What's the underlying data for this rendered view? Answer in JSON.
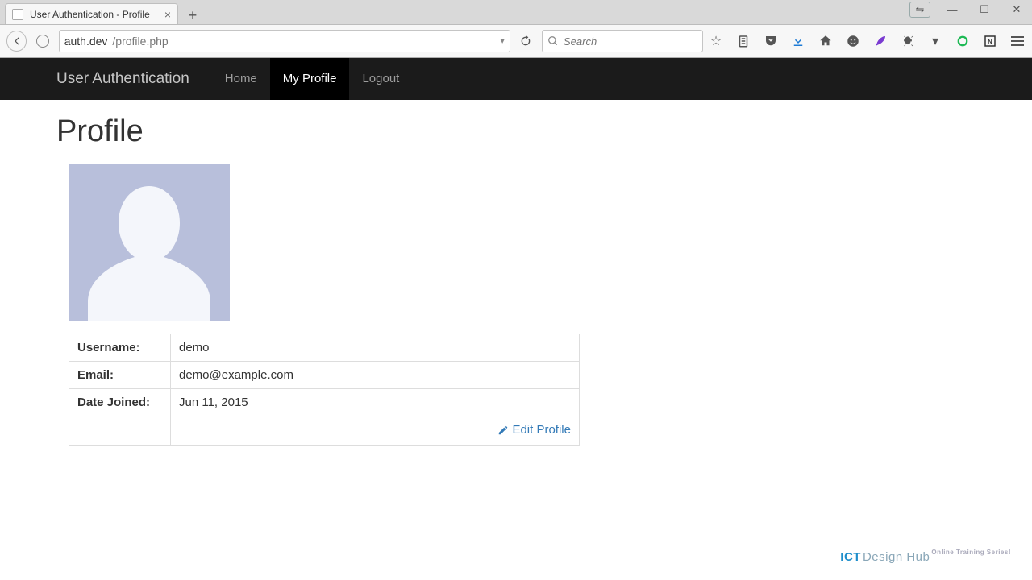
{
  "browser": {
    "tab_title": "User Authentication - Profile",
    "url_host": "auth.dev",
    "url_path": "/profile.php",
    "search_placeholder": "Search"
  },
  "navbar": {
    "brand": "User Authentication",
    "links": {
      "home": "Home",
      "profile": "My Profile",
      "logout": "Logout"
    }
  },
  "page": {
    "heading": "Profile"
  },
  "profile": {
    "labels": {
      "username": "Username:",
      "email": "Email:",
      "date_joined": "Date Joined:"
    },
    "values": {
      "username": "demo",
      "email": "demo@example.com",
      "date_joined": "Jun 11, 2015"
    },
    "edit_link": "Edit Profile"
  },
  "watermark": {
    "strong": "ICT",
    "light": "Design Hub",
    "tag": "Online Training Series!"
  }
}
